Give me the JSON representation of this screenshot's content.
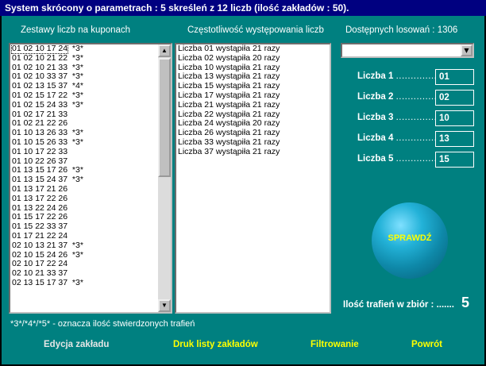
{
  "window": {
    "title": "System skrócony o parametrach : 5 skreśleń z 12 liczb (ilość zakładów : 50)."
  },
  "coupons": {
    "header": "Zestawy liczb na kuponach",
    "rows": [
      {
        "numbers": "01 02 10 17 24",
        "mark": "*3*"
      },
      {
        "numbers": "01 02 10 21 22",
        "mark": "*3*"
      },
      {
        "numbers": "01 02 10 21 33",
        "mark": "*3*"
      },
      {
        "numbers": "01 02 10 33 37",
        "mark": "*3*"
      },
      {
        "numbers": "01 02 13 15 37",
        "mark": "*4*"
      },
      {
        "numbers": "01 02 15 17 22",
        "mark": "*3*"
      },
      {
        "numbers": "01 02 15 24 33",
        "mark": "*3*"
      },
      {
        "numbers": "01 02 17 21 33",
        "mark": ""
      },
      {
        "numbers": "01 02 21 22 26",
        "mark": ""
      },
      {
        "numbers": "01 10 13 26 33",
        "mark": "*3*"
      },
      {
        "numbers": "01 10 15 26 33",
        "mark": "*3*"
      },
      {
        "numbers": "01 10 17 22 33",
        "mark": ""
      },
      {
        "numbers": "01 10 22 26 37",
        "mark": ""
      },
      {
        "numbers": "01 13 15 17 26",
        "mark": "*3*"
      },
      {
        "numbers": "01 13 15 24 37",
        "mark": "*3*"
      },
      {
        "numbers": "01 13 17 21 26",
        "mark": ""
      },
      {
        "numbers": "01 13 17 22 26",
        "mark": ""
      },
      {
        "numbers": "01 13 22 24 26",
        "mark": ""
      },
      {
        "numbers": "01 15 17 22 26",
        "mark": ""
      },
      {
        "numbers": "01 15 22 33 37",
        "mark": ""
      },
      {
        "numbers": "01 17 21 22 24",
        "mark": ""
      },
      {
        "numbers": "02 10 13 21 37",
        "mark": "*3*"
      },
      {
        "numbers": "02 10 15 24 26",
        "mark": "*3*"
      },
      {
        "numbers": "02 10 17 22 24",
        "mark": ""
      },
      {
        "numbers": "02 10 21 33 37",
        "mark": ""
      },
      {
        "numbers": "02 13 15 17 37",
        "mark": "*3*"
      }
    ]
  },
  "frequency": {
    "header": "Częstotliwość występowania liczb",
    "available_label": "Dostępnych losowań : 1306",
    "rows": [
      "Liczba 01 wystąpiła 21 razy",
      "Liczba 02 wystąpiła 20 razy",
      "Liczba 10 wystąpiła 21 razy",
      "Liczba 13 wystąpiła 21 razy",
      "Liczba 15 wystąpiła 21 razy",
      "Liczba 17 wystąpiła 21 razy",
      "Liczba 21 wystąpiła 21 razy",
      "Liczba 22 wystąpiła 21 razy",
      "Liczba 24 wystąpiła 20 razy",
      "Liczba 26 wystąpiła 21 razy",
      "Liczba 33 wystąpiła 21 razy",
      "Liczba 37 wystąpiła 21 razy"
    ]
  },
  "dropdown": {
    "selected": ""
  },
  "numbers": [
    {
      "label": "Liczba 1",
      "dots": "..............",
      "value": "01"
    },
    {
      "label": "Liczba 2",
      "dots": "..............",
      "value": "02"
    },
    {
      "label": "Liczba 3",
      "dots": "..............",
      "value": "10"
    },
    {
      "label": "Liczba 4",
      "dots": "..............",
      "value": "13"
    },
    {
      "label": "Liczba 5",
      "dots": "..............",
      "value": "15"
    }
  ],
  "check_button": {
    "label": "SPRAWDŹ"
  },
  "hits": {
    "label": "Ilość trafień w zbiór : .......",
    "value": "5"
  },
  "legend": "*3*/*4*/*5* - oznacza ilość stwierdzonych trafień",
  "actions": {
    "edit": "Edycja zakładu",
    "print": "Druk listy zakładów",
    "filter": "Filtrowanie",
    "back": "Powrót"
  },
  "colors": {
    "background": "#008080",
    "titlebar": "#000080",
    "accent_yellow": "#ffff00",
    "disabled_button": "#e6e6e6"
  },
  "icons": {
    "scroll_up": "▲",
    "scroll_down": "▼",
    "combo_arrow": "▼"
  }
}
